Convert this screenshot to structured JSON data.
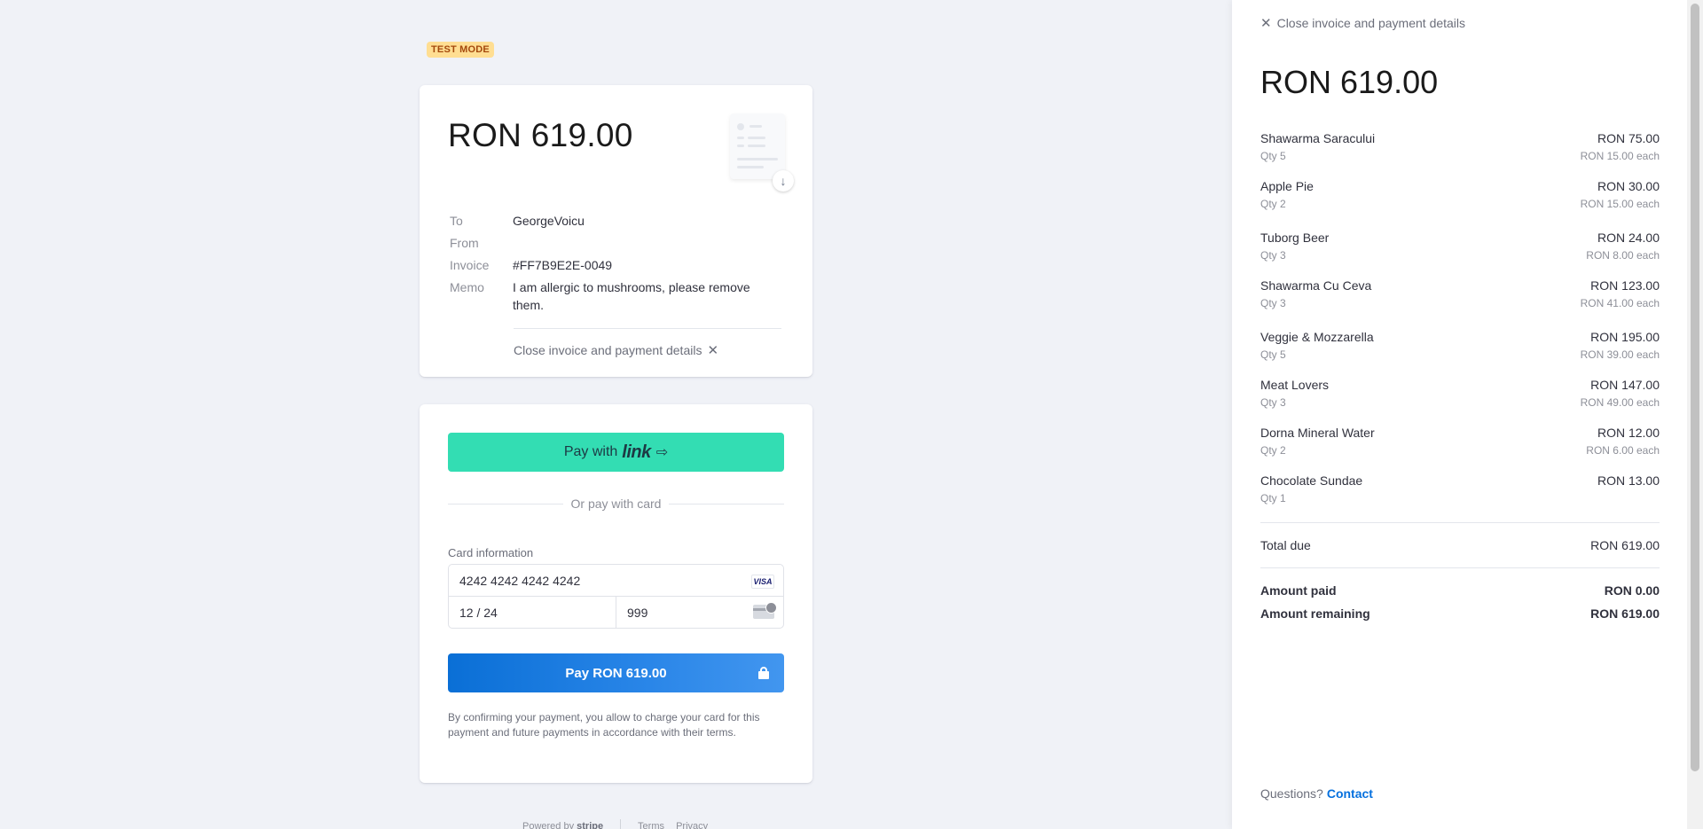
{
  "test_mode_label": "TEST MODE",
  "invoice": {
    "amount": "RON 619.00",
    "meta": [
      {
        "key": "To",
        "value": "GeorgeVoicu"
      },
      {
        "key": "From",
        "value": ""
      },
      {
        "key": "Invoice",
        "value": "#FF7B9E2E-0049"
      },
      {
        "key": "Memo",
        "value": "I am allergic to mushrooms, please remove them."
      }
    ],
    "close_label": "Close invoice and payment details"
  },
  "payment": {
    "link_button_prefix": "Pay with",
    "link_button_logo": "link",
    "or_label": "Or pay with card",
    "card_info_label": "Card information",
    "card_number": "4242 4242 4242 4242",
    "card_brand": "VISA",
    "expiry": "12 / 24",
    "cvc": "999",
    "pay_button_label": "Pay RON 619.00",
    "consent_text": "By confirming your payment, you allow to charge your card for this payment and future payments in accordance with their terms."
  },
  "footer": {
    "powered_by": "Powered by",
    "brand": "stripe",
    "terms": "Terms",
    "privacy": "Privacy"
  },
  "panel": {
    "close_label": "Close invoice and payment details",
    "amount": "RON 619.00",
    "items": [
      {
        "name": "Shawarma Saracului",
        "price": "RON 75.00",
        "qty": "Qty 5",
        "each": "RON 15.00 each"
      },
      {
        "name": "Apple Pie",
        "price": "RON 30.00",
        "qty": "Qty 2",
        "each": "RON 15.00 each"
      },
      {
        "name": "Tuborg Beer",
        "price": "RON 24.00",
        "qty": "Qty 3",
        "each": "RON 8.00 each"
      },
      {
        "name": "Shawarma Cu Ceva",
        "price": "RON 123.00",
        "qty": "Qty 3",
        "each": "RON 41.00 each"
      },
      {
        "name": "Veggie & Mozzarella",
        "price": "RON 195.00",
        "qty": "Qty 5",
        "each": "RON 39.00 each"
      },
      {
        "name": "Meat Lovers",
        "price": "RON 147.00",
        "qty": "Qty 3",
        "each": "RON 49.00 each"
      },
      {
        "name": "Dorna Mineral Water",
        "price": "RON 12.00",
        "qty": "Qty 2",
        "each": "RON 6.00 each"
      },
      {
        "name": "Chocolate Sundae",
        "price": "RON 13.00",
        "qty": "Qty 1",
        "each": ""
      }
    ],
    "total_due_label": "Total due",
    "total_due": "RON 619.00",
    "amount_paid_label": "Amount paid",
    "amount_paid": "RON 0.00",
    "amount_remaining_label": "Amount remaining",
    "amount_remaining": "RON 619.00",
    "questions_label": "Questions?",
    "contact_label": "Contact"
  },
  "colors": {
    "link_green": "#33ddb3",
    "pay_blue": "#0a6fd6",
    "contact_blue": "#0570de",
    "test_badge_bg": "#ffde92"
  }
}
